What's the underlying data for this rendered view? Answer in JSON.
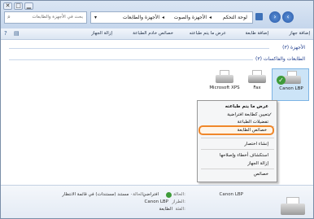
{
  "window": {
    "minimize": "▁",
    "maximize": "□",
    "close": "✕"
  },
  "address": {
    "root": "لوحة التحكم",
    "middle": "الأجهزة والصوت",
    "current": "الأجهزة والطابعات"
  },
  "search": {
    "placeholder": "بحث في الأجهزة والطابعات"
  },
  "toolbar": {
    "add_device": "إضافة جهاز",
    "add_printer": "إضافة طابعة",
    "see_printing": "عرض ما يتم طباعته",
    "print_server_props": "خصائص خادم الطباعة",
    "remove_device": "إزالة الجهاز"
  },
  "groups": {
    "devices": "الأجهزة (٣)",
    "printers": "الطابعات والفاكسات (٣)"
  },
  "printers": [
    {
      "label": "Microsoft XPS"
    },
    {
      "label": "Fax"
    },
    {
      "label": "Canon LBP"
    }
  ],
  "context_menu": {
    "items": [
      "عرض ما يتم طباعته",
      "تعيين كطابعة افتراضية",
      "تفضيلات الطباعة",
      "خصائص الطابعة",
      "إنشاء اختصار",
      "استكشاف أخطاء وإصلاحها",
      "إزالة الجهاز",
      "خصائص"
    ]
  },
  "details": {
    "name": "Canon LBP",
    "state_label": "الحالة:",
    "state_value": "افتراضي",
    "status_label": "الحالة:",
    "status_value": "٠ مستند (مستندات) في قائمة الانتظار",
    "model_label": "الطراز:",
    "model_value": "Canon LBP",
    "category_label": "الفئة:",
    "category_value": "الطابعة"
  },
  "colors": {
    "accent": "#f0872a",
    "selection": "#cce4f7",
    "group_text": "#1e3c8c"
  }
}
